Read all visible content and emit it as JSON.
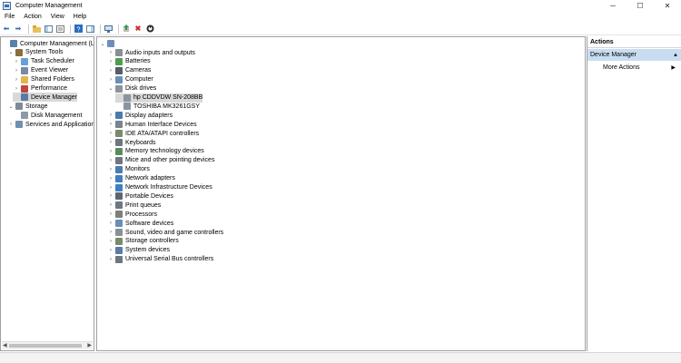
{
  "window": {
    "title": "Computer Management",
    "controls": {
      "minimize": "─",
      "maximize": "☐",
      "close": "✕"
    }
  },
  "menu": [
    "File",
    "Action",
    "View",
    "Help"
  ],
  "toolbar": {
    "icons": [
      "back-arrow-icon",
      "forward-arrow-icon",
      "up-folder-icon",
      "show-hide-tree-icon",
      "properties-icon",
      "help-icon",
      "show-console-tree-icon",
      "monitor-icon",
      "update-driver-icon",
      "uninstall-icon",
      "disable-device-icon"
    ]
  },
  "left_tree": [
    {
      "label": "Computer Management (Local",
      "level": 0,
      "expander": "",
      "icon": "computer-management-icon"
    },
    {
      "label": "System Tools",
      "level": 1,
      "expander": "⌄",
      "icon": "tools-icon"
    },
    {
      "label": "Task Scheduler",
      "level": 2,
      "expander": "›",
      "icon": "clock-icon"
    },
    {
      "label": "Event Viewer",
      "level": 2,
      "expander": "›",
      "icon": "event-viewer-icon"
    },
    {
      "label": "Shared Folders",
      "level": 2,
      "expander": "›",
      "icon": "folder-icon"
    },
    {
      "label": "Performance",
      "level": 2,
      "expander": "›",
      "icon": "performance-icon"
    },
    {
      "label": "Device Manager",
      "level": 2,
      "expander": "",
      "icon": "device-manager-icon",
      "selected": true
    },
    {
      "label": "Storage",
      "level": 1,
      "expander": "⌄",
      "icon": "storage-icon"
    },
    {
      "label": "Disk Management",
      "level": 2,
      "expander": "",
      "icon": "disk-icon"
    },
    {
      "label": "Services and Applications",
      "level": 1,
      "expander": "›",
      "icon": "services-icon"
    }
  ],
  "device_tree": {
    "root_label": "",
    "items": [
      {
        "label": "Audio inputs and outputs",
        "expander": "›",
        "icon": "speaker-icon",
        "level": 1
      },
      {
        "label": "Batteries",
        "expander": "›",
        "icon": "battery-icon",
        "level": 1
      },
      {
        "label": "Cameras",
        "expander": "›",
        "icon": "camera-icon",
        "level": 1
      },
      {
        "label": "Computer",
        "expander": "›",
        "icon": "computer-icon",
        "level": 1
      },
      {
        "label": "Disk drives",
        "expander": "⌄",
        "icon": "disk-drive-icon",
        "level": 1
      },
      {
        "label": "hp        CDDVDW SN-208BB",
        "expander": "",
        "icon": "disk-drive-icon",
        "level": 2,
        "selected": true
      },
      {
        "label": "TOSHIBA MK3261GSY",
        "expander": "",
        "icon": "disk-drive-icon",
        "level": 2
      },
      {
        "label": "Display adapters",
        "expander": "›",
        "icon": "display-adapter-icon",
        "level": 1
      },
      {
        "label": "Human Interface Devices",
        "expander": "›",
        "icon": "hid-icon",
        "level": 1
      },
      {
        "label": "IDE ATA/ATAPI controllers",
        "expander": "›",
        "icon": "ide-controller-icon",
        "level": 1
      },
      {
        "label": "Keyboards",
        "expander": "›",
        "icon": "keyboard-icon",
        "level": 1
      },
      {
        "label": "Memory technology devices",
        "expander": "›",
        "icon": "memory-icon",
        "level": 1
      },
      {
        "label": "Mice and other pointing devices",
        "expander": "›",
        "icon": "mouse-icon",
        "level": 1
      },
      {
        "label": "Monitors",
        "expander": "›",
        "icon": "monitor-icon",
        "level": 1
      },
      {
        "label": "Network adapters",
        "expander": "›",
        "icon": "network-adapter-icon",
        "level": 1
      },
      {
        "label": "Network Infrastructure Devices",
        "expander": "›",
        "icon": "network-infrastructure-icon",
        "level": 1
      },
      {
        "label": "Portable Devices",
        "expander": "›",
        "icon": "portable-device-icon",
        "level": 1
      },
      {
        "label": "Print queues",
        "expander": "›",
        "icon": "printer-icon",
        "level": 1
      },
      {
        "label": "Processors",
        "expander": "›",
        "icon": "processor-icon",
        "level": 1
      },
      {
        "label": "Software devices",
        "expander": "›",
        "icon": "software-device-icon",
        "level": 1
      },
      {
        "label": "Sound, video and game controllers",
        "expander": "›",
        "icon": "sound-icon",
        "level": 1
      },
      {
        "label": "Storage controllers",
        "expander": "›",
        "icon": "storage-controller-icon",
        "level": 1
      },
      {
        "label": "System devices",
        "expander": "›",
        "icon": "system-device-icon",
        "level": 1
      },
      {
        "label": "Universal Serial Bus controllers",
        "expander": "›",
        "icon": "usb-icon",
        "level": 1
      }
    ]
  },
  "actions": {
    "header": "Actions",
    "section": "Device Manager",
    "items": [
      "More Actions"
    ]
  },
  "colors": {
    "selection_gray": "#d9d9d9",
    "selection_blue": "#c9ddf2",
    "pane_border": "#a0a0a0"
  }
}
